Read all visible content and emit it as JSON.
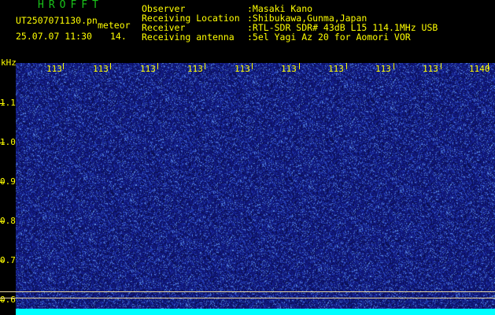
{
  "brand": "HROFFT",
  "filename": "UT2507071130.pn",
  "mode": "meteor",
  "datetime": "25.07.07 11:30",
  "count": "14.",
  "meta": [
    {
      "label": "Observer",
      "value": ":Masaki Kano"
    },
    {
      "label": "Receiving Location",
      "value": ":Shibukawa,Gunma,Japan"
    },
    {
      "label": "Receiver",
      "value": ":RTL-SDR SDR# 43dB L15 114.1MHz USB"
    },
    {
      "label": "Receiving antenna",
      "value": ":5el Yagi Az 20 for Aomori VOR"
    }
  ],
  "yaxis": {
    "unit": "kHz",
    "ticks": [
      "1.1",
      "1.0",
      "0.9",
      "0.8",
      "0.7",
      "0.6"
    ]
  },
  "xaxis": {
    "ticks": [
      "113",
      "113",
      "113",
      "113",
      "113",
      "113",
      "113",
      "113",
      "113",
      "1140"
    ]
  },
  "colors": {
    "background": "#000000",
    "header_text": "#ffff00",
    "brand_text": "#19c419",
    "waterfall_base": "#1a2a8c",
    "noise_floor": "#00ffff"
  }
}
